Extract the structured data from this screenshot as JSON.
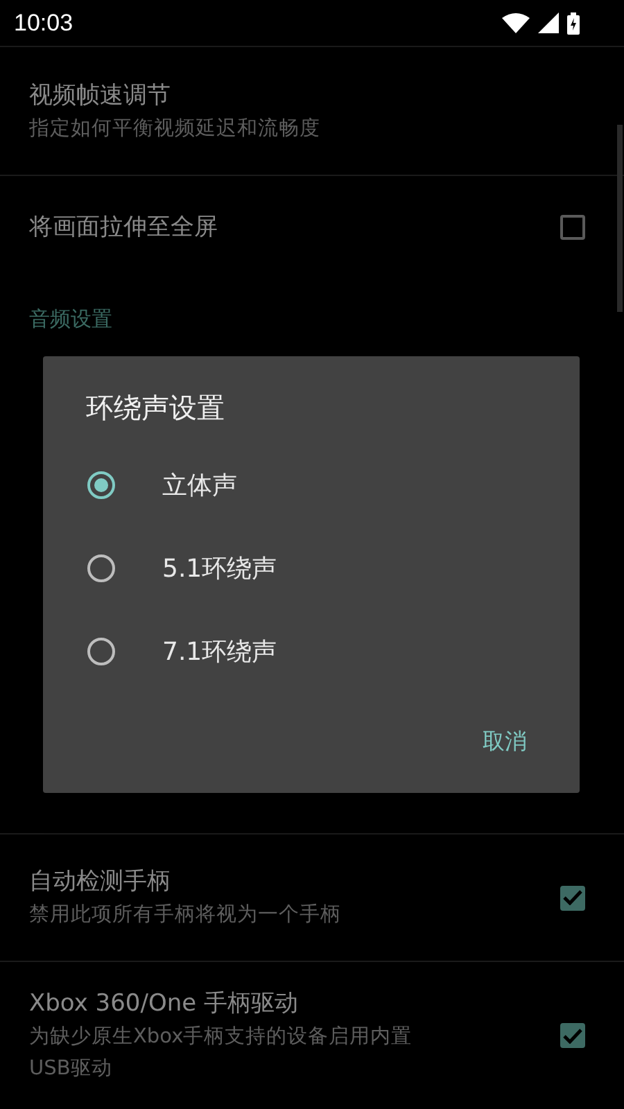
{
  "status_bar": {
    "time": "10:03"
  },
  "settings": [
    {
      "kind": "item",
      "title": "视频帧速调节",
      "summary": [
        "指定如何平衡视频延迟和流畅度"
      ]
    },
    {
      "kind": "item",
      "title": "将画面拉伸至全屏",
      "checked": false
    },
    {
      "kind": "header",
      "title": "音频设置"
    },
    {
      "kind": "item",
      "title": "自动检测手柄",
      "summary": [
        "禁用此项所有手柄将视为一个手柄"
      ],
      "checked": true
    },
    {
      "kind": "item",
      "title": "Xbox 360/One 手柄驱动",
      "summary": [
        "为缺少原生Xbox手柄支持的设备启用内置",
        "USB驱动"
      ],
      "checked": true
    }
  ],
  "dialog": {
    "title": "环绕声设置",
    "options": [
      {
        "label": "立体声",
        "selected": true
      },
      {
        "label": "5.1环绕声",
        "selected": false
      },
      {
        "label": "7.1环绕声",
        "selected": false
      }
    ],
    "buttons": [
      "取消"
    ]
  }
}
